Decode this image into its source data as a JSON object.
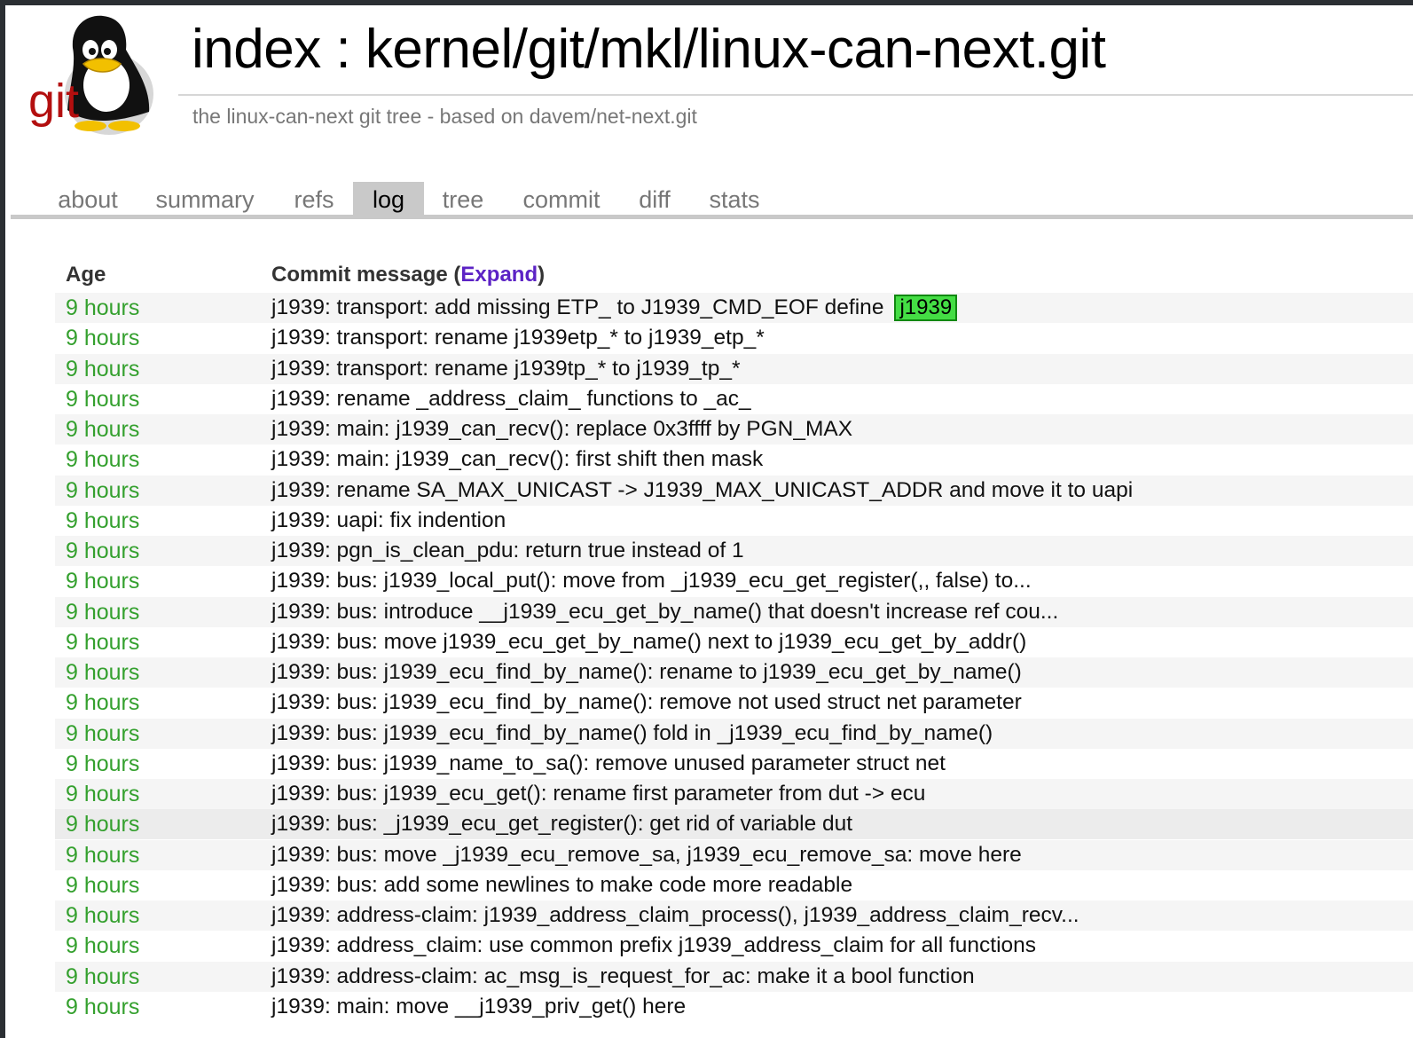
{
  "header": {
    "logo_text": "git",
    "title": "index : kernel/git/mkl/linux-can-next.git",
    "description": "the linux-can-next git tree - based on davem/net-next.git"
  },
  "tabs": [
    {
      "label": "about",
      "active": false
    },
    {
      "label": "summary",
      "active": false
    },
    {
      "label": "refs",
      "active": false
    },
    {
      "label": "log",
      "active": true
    },
    {
      "label": "tree",
      "active": false
    },
    {
      "label": "commit",
      "active": false
    },
    {
      "label": "diff",
      "active": false
    },
    {
      "label": "stats",
      "active": false
    }
  ],
  "log": {
    "col_age": "Age",
    "col_message": "Commit message",
    "expand_label": "Expand",
    "badge": "j1939",
    "rows": [
      {
        "age": "9 hours",
        "message": "j1939: transport: add missing ETP_ to J1939_CMD_EOF define"
      },
      {
        "age": "9 hours",
        "message": "j1939: transport: rename j1939etp_* to j1939_etp_*"
      },
      {
        "age": "9 hours",
        "message": "j1939: transport: rename j1939tp_* to j1939_tp_*"
      },
      {
        "age": "9 hours",
        "message": "j1939: rename _address_claim_ functions to _ac_"
      },
      {
        "age": "9 hours",
        "message": "j1939: main: j1939_can_recv(): replace 0x3ffff by PGN_MAX"
      },
      {
        "age": "9 hours",
        "message": "j1939: main: j1939_can_recv(): first shift then mask"
      },
      {
        "age": "9 hours",
        "message": "j1939: rename SA_MAX_UNICAST -> J1939_MAX_UNICAST_ADDR and move it to uapi"
      },
      {
        "age": "9 hours",
        "message": "j1939: uapi: fix indention"
      },
      {
        "age": "9 hours",
        "message": "j1939: pgn_is_clean_pdu: return true instead of 1"
      },
      {
        "age": "9 hours",
        "message": "j1939: bus: j1939_local_put(): move from _j1939_ecu_get_register(,, false) to..."
      },
      {
        "age": "9 hours",
        "message": "j1939: bus: introduce __j1939_ecu_get_by_name() that doesn't increase ref cou..."
      },
      {
        "age": "9 hours",
        "message": "j1939: bus: move j1939_ecu_get_by_name() next to j1939_ecu_get_by_addr()"
      },
      {
        "age": "9 hours",
        "message": "j1939: bus: j1939_ecu_find_by_name(): rename to j1939_ecu_get_by_name()"
      },
      {
        "age": "9 hours",
        "message": "j1939: bus: j1939_ecu_find_by_name(): remove not used struct net parameter"
      },
      {
        "age": "9 hours",
        "message": "j1939: bus: j1939_ecu_find_by_name() fold in _j1939_ecu_find_by_name()"
      },
      {
        "age": "9 hours",
        "message": "j1939: bus: j1939_name_to_sa(): remove unused parameter struct net"
      },
      {
        "age": "9 hours",
        "message": "j1939: bus: j1939_ecu_get(): rename first parameter from dut -> ecu"
      },
      {
        "age": "9 hours",
        "message": "j1939: bus: _j1939_ecu_get_register(): get rid of variable dut"
      },
      {
        "age": "9 hours",
        "message": "j1939: bus: move _j1939_ecu_remove_sa, j1939_ecu_remove_sa: move here"
      },
      {
        "age": "9 hours",
        "message": "j1939: bus: add some newlines to make code more readable"
      },
      {
        "age": "9 hours",
        "message": "j1939: address-claim: j1939_address_claim_process(), j1939_address_claim_recv..."
      },
      {
        "age": "9 hours",
        "message": "j1939: address_claim: use common prefix j1939_address_claim for all functions"
      },
      {
        "age": "9 hours",
        "message": "j1939: address-claim: ac_msg_is_request_for_ac: make it a bool function"
      },
      {
        "age": "9 hours",
        "message": "j1939: main: move __j1939_priv_get() here"
      }
    ]
  },
  "colors": {
    "age_green": "#34a02e",
    "expand_link": "#5c23c5",
    "badge_bg": "#44dd44",
    "badge_border": "#118811",
    "active_tab": "#c9c9c9"
  }
}
